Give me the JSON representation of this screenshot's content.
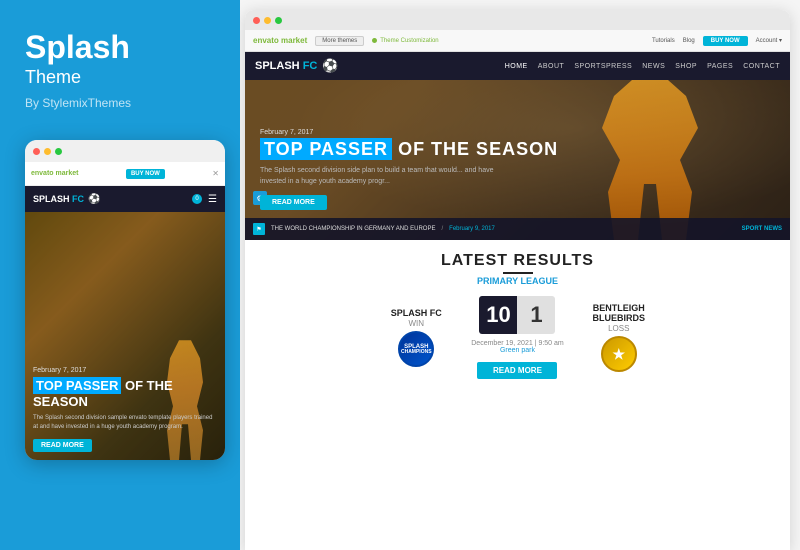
{
  "left": {
    "title": "Splash",
    "subtitle": "Theme",
    "author": "By StylemixThemes"
  },
  "mobile": {
    "brand": "SPLASH",
    "brand_accent": "FC",
    "hero_date": "February 7, 2017",
    "hero_title_part1": "TOP PASSER",
    "hero_title_part2": "OF THE SEASON",
    "hero_text": "The Splash second division sample envato template players trained at and have invested in a huge youth academy program.",
    "read_more": "READ MORE"
  },
  "desktop": {
    "brand": "SPLASH",
    "brand_accent": "FC",
    "nav_links": [
      "HOME",
      "ABOUT",
      "SPORTSPRESS",
      "NEWS",
      "SHOP",
      "PAGES",
      "CONTACT"
    ],
    "hero_date": "February 7, 2017",
    "hero_title_part1": "TOP PASSER",
    "hero_title_part2": "OF THE SEASON",
    "hero_subtitle": "The Splash second division side plan to build a team that would... and have invested in a huge youth academy progr...",
    "read_more": "READ MORE",
    "ticker_text": "THE WORLD CHAMPIONSHIP IN GERMANY AND EUROPE",
    "ticker_date": "February 9, 2017",
    "ticker_right": "SPORT NEWS",
    "topbar": {
      "logo": "envato market",
      "more_themes": "More themes",
      "theme_cust": "Theme Customization",
      "tutorials": "Tutorials",
      "blog": "Blog",
      "buy_now": "BUY NOW"
    }
  },
  "results": {
    "section_title": "LATEST RESULTS",
    "league": "Primary League",
    "home_team": "SPLASH FC",
    "home_result": "WIN",
    "home_score": "10",
    "away_score": "1",
    "away_team": "BENTLEIGH BLUEBIRDS",
    "away_result": "LOSS",
    "match_date": "December 19, 2021 | 9:50 am",
    "match_venue": "Green park",
    "read_more": "READ MORE"
  },
  "icons": {
    "soccer": "⚽",
    "gear": "⚙",
    "cart": "🛒",
    "menu": "☰",
    "flag": "⚑",
    "video": "▶"
  },
  "colors": {
    "accent": "#00b4d8",
    "dark_nav": "#1a1a2e",
    "left_bg": "#1a9cd8"
  }
}
